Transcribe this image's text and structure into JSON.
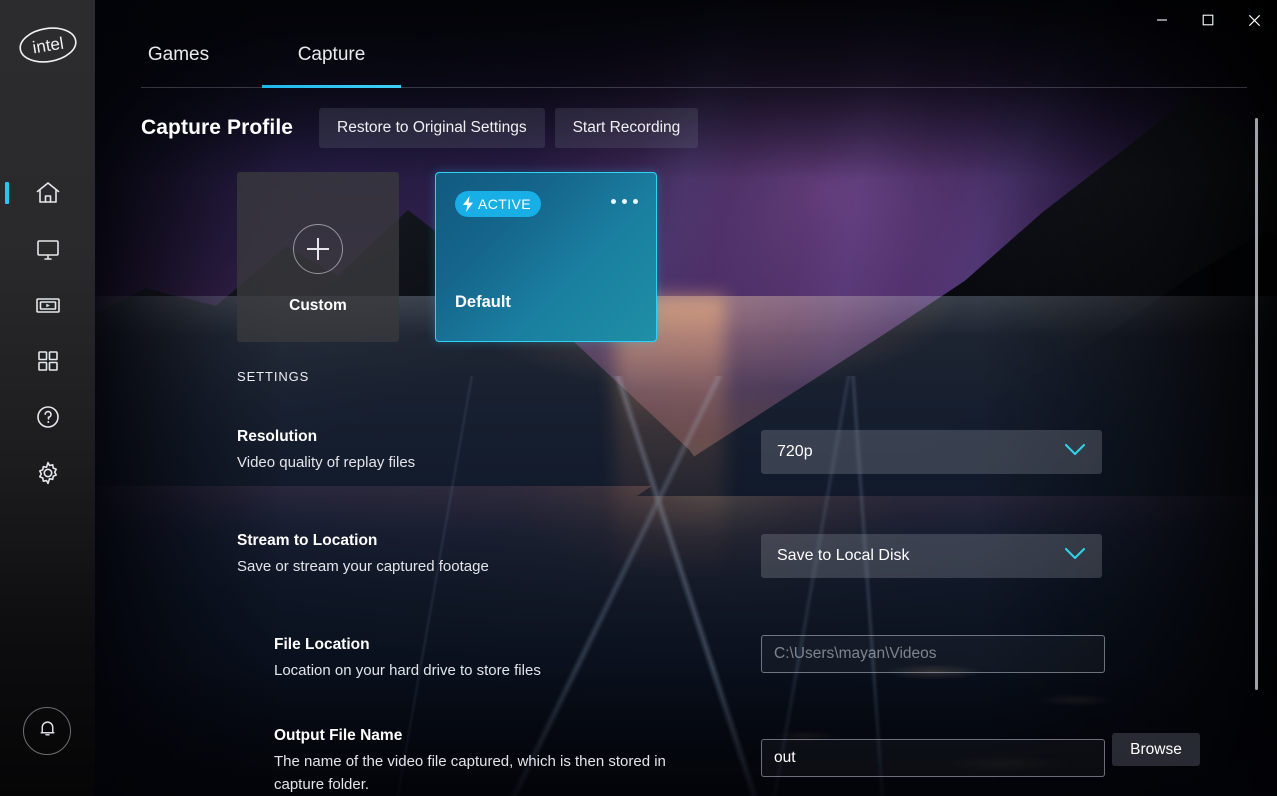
{
  "window": {
    "minimize_label": "─",
    "maximize_label": "□",
    "close_label": "✕"
  },
  "sidebar": {
    "logo_text": "intel",
    "items": [
      {
        "name": "home",
        "icon": "home-icon",
        "active": true
      },
      {
        "name": "display",
        "icon": "monitor-icon",
        "active": false
      },
      {
        "name": "media",
        "icon": "video-capture-icon",
        "active": false
      },
      {
        "name": "apps",
        "icon": "grid-apps-icon",
        "active": false
      },
      {
        "name": "help",
        "icon": "question-circle-icon",
        "active": false
      },
      {
        "name": "settings",
        "icon": "gear-icon",
        "active": false
      }
    ],
    "notification_icon": "bell-icon"
  },
  "tabs": [
    {
      "label": "Games",
      "active": false
    },
    {
      "label": "Capture",
      "active": true
    }
  ],
  "header": {
    "title": "Capture Profile",
    "restore_button": "Restore to Original Settings",
    "record_button": "Start Recording"
  },
  "profiles": {
    "custom": {
      "label": "Custom",
      "icon": "plus-icon"
    },
    "default": {
      "label": "Default",
      "badge": "ACTIVE",
      "badge_icon": "lightning-bolt-icon",
      "menu_icon": "more-options-icon"
    }
  },
  "settings_section_label": "SETTINGS",
  "settings": {
    "resolution": {
      "title": "Resolution",
      "description": "Video quality of replay files",
      "value": "720p"
    },
    "stream_to_location": {
      "title": "Stream to Location",
      "description": "Save or stream your captured footage",
      "value": "Save to Local Disk"
    },
    "file_location": {
      "title": "File Location",
      "description": "Location on your hard drive to store files",
      "placeholder": "C:\\Users\\mayan\\Videos",
      "browse_label": "Browse"
    },
    "output_file_name": {
      "title": "Output File Name",
      "description": "The name of the video file captured, which is then stored in capture folder.",
      "value": "out"
    }
  },
  "colors": {
    "accent": "#29c5f6",
    "badge": "#18aee6",
    "card_border": "#2fd2f5",
    "chevron": "#2fd2e8"
  }
}
